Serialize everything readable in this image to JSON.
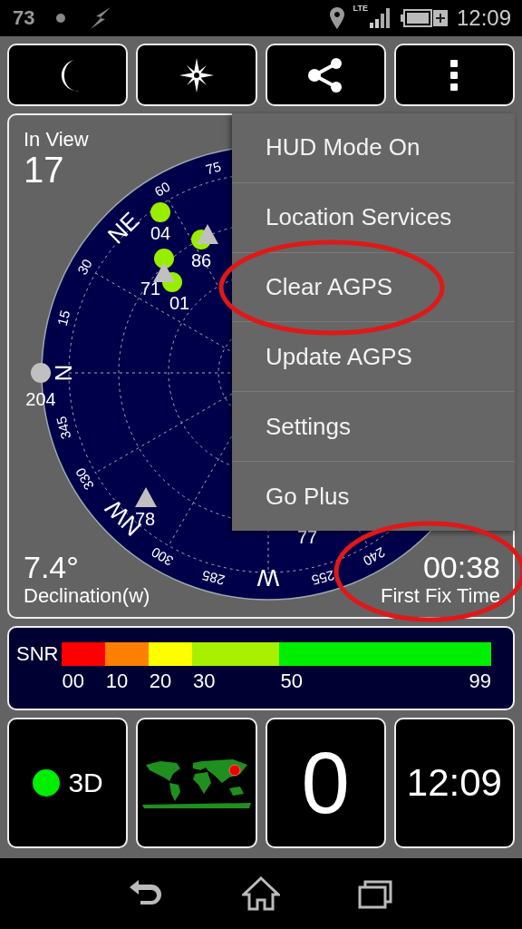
{
  "status_bar": {
    "left_number": "73",
    "network_label": "LTE",
    "time": "12:09"
  },
  "toolbar": [
    {
      "kind": "night"
    },
    {
      "kind": "compass"
    },
    {
      "kind": "share"
    },
    {
      "kind": "overflow"
    }
  ],
  "sky_view": {
    "in_view_label": "In View",
    "in_view_count": "17",
    "declination_value": "7.4°",
    "declination_label": "Declination(w)",
    "first_fix_value": "00:38",
    "first_fix_label": "First Fix Time",
    "azimuth_labels": [
      {
        "text": "15",
        "kind": "degree"
      },
      {
        "text": "30",
        "kind": "degree"
      },
      {
        "text": "NE",
        "kind": "cardinal"
      },
      {
        "text": "60",
        "kind": "degree"
      },
      {
        "text": "75",
        "kind": "degree"
      },
      {
        "text": "240",
        "kind": "degree"
      },
      {
        "text": "255",
        "kind": "degree"
      },
      {
        "text": "W",
        "kind": "cardinal"
      },
      {
        "text": "285",
        "kind": "degree"
      },
      {
        "text": "300",
        "kind": "degree"
      },
      {
        "text": "NW",
        "kind": "cardinal"
      },
      {
        "text": "330",
        "kind": "degree"
      },
      {
        "text": "345",
        "kind": "degree"
      },
      {
        "text": "N",
        "kind": "cardinal"
      }
    ],
    "satellites": [
      {
        "label": "04",
        "kind": "circle",
        "color": "#99ee00"
      },
      {
        "label": "86",
        "kind": "circle",
        "color": "#99ee00"
      },
      {
        "kind": "triangle",
        "color": "#c0c0c0"
      },
      {
        "kind": "circle",
        "color": "#99ee00"
      },
      {
        "label": "01",
        "kind": "circle",
        "color": "#99ee00"
      },
      {
        "label": "71",
        "kind": "triangle",
        "color": "#c0c0c0"
      },
      {
        "label": "204",
        "kind": "circle",
        "color": "#c0c0c0"
      },
      {
        "label": "78",
        "kind": "triangle",
        "color": "#c0c0c0"
      },
      {
        "label": "77",
        "kind": "label"
      }
    ]
  },
  "menu": [
    {
      "label": "HUD Mode On"
    },
    {
      "label": "Location Services"
    },
    {
      "label": "Clear AGPS"
    },
    {
      "label": "Update AGPS"
    },
    {
      "label": "Settings"
    },
    {
      "label": "Go Plus"
    }
  ],
  "snr": {
    "label": "SNR",
    "segments": [
      {
        "label": "00",
        "color": "#ff0000"
      },
      {
        "label": "10",
        "color": "#ff7f00"
      },
      {
        "label": "20",
        "color": "#ffff00"
      },
      {
        "label": "30",
        "color": "#a6f000"
      },
      {
        "label": "50",
        "color": "#00ee00"
      }
    ],
    "end_label": "99"
  },
  "tiles": {
    "fix": {
      "label": "3D",
      "color": "#00ee00"
    },
    "satellites_used": "0",
    "clock": "12:09"
  }
}
